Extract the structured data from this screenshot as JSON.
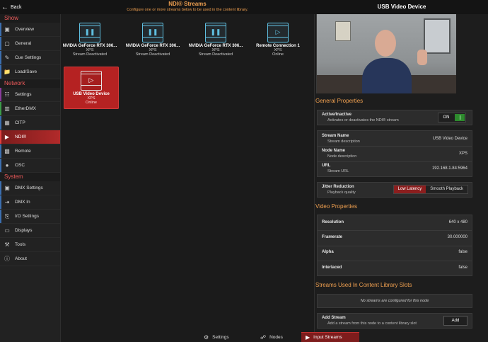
{
  "header": {
    "back_label": "Back",
    "title": "NDI® Streams",
    "subtitle": "Configure one or more streams below to be used in the content library.",
    "panel_title": "USB Video Device"
  },
  "sidebar": {
    "sections": [
      {
        "label": "Show",
        "items": [
          {
            "label": "Overview",
            "icon": "overview-icon"
          },
          {
            "label": "General",
            "icon": "general-icon"
          },
          {
            "label": "Cue Settings",
            "icon": "cue-settings-icon"
          },
          {
            "label": "Load/Save",
            "icon": "folder-icon"
          }
        ]
      },
      {
        "label": "Network",
        "items": [
          {
            "label": "Settings",
            "icon": "network-settings-icon"
          },
          {
            "label": "EtherDMX",
            "icon": "etherdmx-icon"
          },
          {
            "label": "CITP",
            "icon": "citp-icon"
          },
          {
            "label": "NDI®",
            "icon": "ndi-icon",
            "active": true
          },
          {
            "label": "Remote",
            "icon": "remote-icon"
          },
          {
            "label": "OSC",
            "icon": "osc-icon"
          }
        ]
      },
      {
        "label": "System",
        "items": [
          {
            "label": "DMX Settings",
            "icon": "dmx-settings-icon"
          },
          {
            "label": "DMX In",
            "icon": "dmx-in-icon"
          },
          {
            "label": "I/O Settings",
            "icon": "io-settings-icon"
          },
          {
            "label": "Displays",
            "icon": "displays-icon"
          },
          {
            "label": "Tools",
            "icon": "tools-icon"
          },
          {
            "label": "About",
            "icon": "info-icon"
          }
        ]
      }
    ]
  },
  "streams": [
    {
      "name": "NVIDIA GeForce RTX 306...",
      "host": "XPS",
      "status": "Stream Deactivated",
      "icon": "pause-icon"
    },
    {
      "name": "NVIDIA GeForce RTX 306...",
      "host": "XPS",
      "status": "Stream Deactivated",
      "icon": "pause-icon"
    },
    {
      "name": "NVIDIA GeForce RTX 306...",
      "host": "XPS",
      "status": "Stream Deactivated",
      "icon": "pause-icon"
    },
    {
      "name": "Remote Connection 1",
      "host": "XPS",
      "status": "Online",
      "icon": "play-icon"
    },
    {
      "name": "USB Video Device",
      "host": "XPS",
      "status": "Online",
      "icon": "play-icon",
      "selected": true
    }
  ],
  "general": {
    "title": "General Properties",
    "active_label": "Active/Inactive",
    "active_sub": "Activates or deactivates the NDI® stream",
    "active_state": "ON",
    "stream_name_label": "Stream Name",
    "stream_name_sub": "Stream description",
    "stream_name_value": "USB Video Device",
    "node_name_label": "Node Name",
    "node_name_sub": "Node description",
    "node_name_value": "XPS",
    "url_label": "URL",
    "url_sub": "Stream URL",
    "url_value": "192.168.1.84:5964",
    "jitter_label": "Jitter Reduction",
    "jitter_sub": "Playback quality",
    "jitter_options": [
      "Low Latency",
      "Smooth Playback"
    ],
    "jitter_selected": "Low Latency"
  },
  "video": {
    "title": "Video Properties",
    "resolution_label": "Resolution",
    "resolution_value": "640 x 480",
    "framerate_label": "Framerate",
    "framerate_value": "30.000000",
    "alpha_label": "Alpha",
    "alpha_value": "false",
    "interlaced_label": "Interlaced",
    "interlaced_value": "false"
  },
  "slots": {
    "title": "Streams Used In Content Library Slots",
    "empty_message": "No streams are configured for this node",
    "add_label": "Add Stream",
    "add_sub": "Add a stream from this node to a content library slot",
    "add_button": "Add"
  },
  "bottom_tabs": [
    {
      "label": "Settings",
      "icon": "gear-icon"
    },
    {
      "label": "Nodes",
      "icon": "nodes-icon"
    },
    {
      "label": "Input Streams",
      "icon": "input-streams-icon",
      "active": true
    }
  ],
  "colors": {
    "accent": "#f0a050",
    "section_red": "#ee5a5a",
    "active_red": "#b52222",
    "online_blue": "#5fbfe0",
    "toggle_green": "#2d8a2d"
  }
}
